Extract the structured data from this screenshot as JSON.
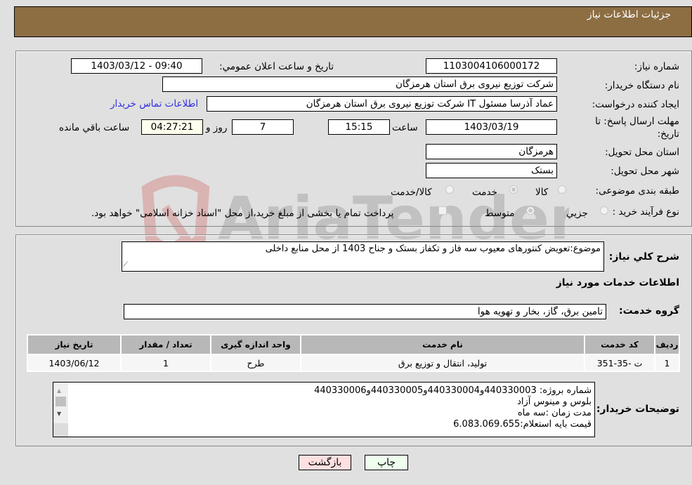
{
  "header": {
    "title": "جزئیات اطلاعات نیاز"
  },
  "info": {
    "need_number_label": "شماره نیاز:",
    "need_number": "1103004106000172",
    "announce_label": "تاریخ و ساعت اعلان عمومي:",
    "announce_value": "1403/03/12 - 09:40",
    "buyer_org_label": "نام دستگاه خریدار:",
    "buyer_org": "شرکت توزیع نیروی برق استان هرمزگان",
    "creator_label": "ایجاد کننده درخواست:",
    "creator": "عماد آذرسا مسئول IT شرکت توزیع نیروی برق استان هرمزگان",
    "contact_link": "اطلاعات تماس خریدار",
    "deadline_label": "مهلت ارسال پاسخ: تا تاریخ:",
    "deadline_date": "1403/03/19",
    "time_label": "ساعت",
    "deadline_time": "15:15",
    "days_value": "7",
    "days_label": "روز و",
    "remaining_time": "04:27:21",
    "remaining_label": "ساعت باقي مانده",
    "province_label": "استان محل تحویل:",
    "province": "هرمزگان",
    "city_label": "شهر محل تحویل:",
    "city": "بستک",
    "category_label": "طبقه بندی موضوعی:",
    "category_options": [
      {
        "label": "کالا",
        "selected": false
      },
      {
        "label": "خدمت",
        "selected": true
      },
      {
        "label": "کالا/خدمت",
        "selected": false
      }
    ],
    "process_label": "نوع فرآیند خرید :",
    "process_options": [
      {
        "label": "جزيي",
        "selected": false
      },
      {
        "label": "متوسط",
        "selected": true
      }
    ],
    "treasury_checkbox_label": "پرداخت تمام یا بخشی از مبلغ خرید،از محل \"اسناد خزانه اسلامی\" خواهد بود.",
    "treasury_checked": false
  },
  "details": {
    "description_label": "شرح کلي نیاز:",
    "description": "موضوع:تعویض کنتورهای معیوب سه فاز و تکفاز بستک و جناح 1403 از محل منابع داخلی",
    "services_heading": "اطلاعات خدمات مورد نیاز",
    "service_group_label": "گروه خدمت:",
    "service_group": "تامین برق، گاز، بخار و تهویه هوا",
    "table": {
      "headers": [
        "ردیف",
        "کد خدمت",
        "نام خدمت",
        "واحد اندازه گیری",
        "تعداد / مقدار",
        "تاریخ نیاز"
      ],
      "rows": [
        [
          "1",
          "ت -35-351",
          "تولید، انتقال و توزیع برق",
          "طرح",
          "1",
          "1403/06/12"
        ]
      ]
    },
    "buyer_notes_label": "توضیحات خریدار:",
    "buyer_notes_lines": [
      "شماره بروژه:  440330003و440330004و440330005و440330006",
      " بلوس و مینوس آزاد",
      "مدت زمان :سه ماه",
      "قیمت بایه استعلام:6.083.069.655"
    ]
  },
  "buttons": {
    "print": "چاپ",
    "back": "بازگشت"
  },
  "watermark": {
    "text": "AriaTender.neT"
  },
  "colors": {
    "header": "#8d6e43",
    "print_bg": "#eeffee",
    "back_bg": "#ffe0e0",
    "link": "#2e2ee0"
  }
}
